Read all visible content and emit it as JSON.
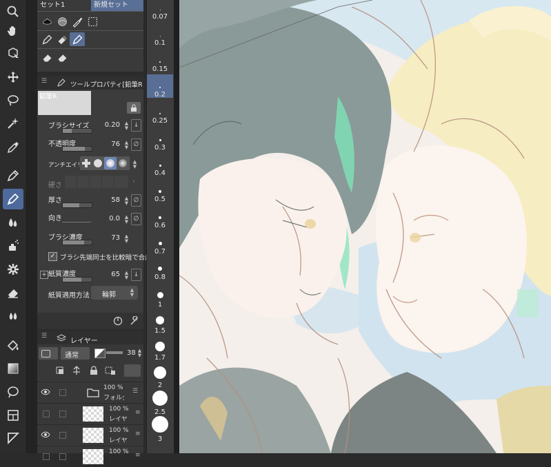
{
  "subtool": {
    "tab1": "セット1",
    "tab2": "新規セット"
  },
  "toolprop": {
    "title": "ツールプロパティ[鉛筆R",
    "preview_name": "鉛筆R",
    "brush_size_label": "ブラシサイズ",
    "brush_size_value": "0.20",
    "brush_size_level": 0.3,
    "opacity_label": "不透明度",
    "opacity_value": "76",
    "opacity_level": 0.76,
    "antialias_label": "アンチエイリ",
    "hardness_label": "硬さ",
    "thickness_label": "厚さ",
    "thickness_value": "58",
    "thickness_level": 0.58,
    "direction_label": "向き",
    "direction_value": "0.0",
    "brush_density_label": "ブラシ濃度",
    "brush_density_value": "73",
    "brush_density_level": 0.73,
    "compare_label": "ブラシ先端同士を比較暗で合成",
    "paper_density_label": "紙質濃度",
    "paper_density_value": "65",
    "paper_density_level": 0.65,
    "paper_method_label": "紙質適用方法",
    "paper_method_value": "輪郭"
  },
  "brush_sizes": [
    "0.07",
    "0.1",
    "0.15",
    "0.2",
    "0.25",
    "0.3",
    "0.4",
    "0.5",
    "0.6",
    "0.7",
    "0.8",
    "1",
    "1.5",
    "1.7",
    "2",
    "2.5",
    "3"
  ],
  "layers": {
    "title": "レイヤー",
    "blend_mode": "通常",
    "opacity": "38",
    "rows": [
      {
        "pct": "100 %",
        "name": "フォルダ"
      },
      {
        "pct": "100 %",
        "name": "レイヤ"
      },
      {
        "pct": "100 %",
        "name": "レイヤ"
      },
      {
        "pct": "100 %",
        "name": ""
      }
    ]
  },
  "colors": {
    "accent": "#586e94",
    "panel": "#3c3c3c",
    "toolbar": "#2c2c2c"
  }
}
